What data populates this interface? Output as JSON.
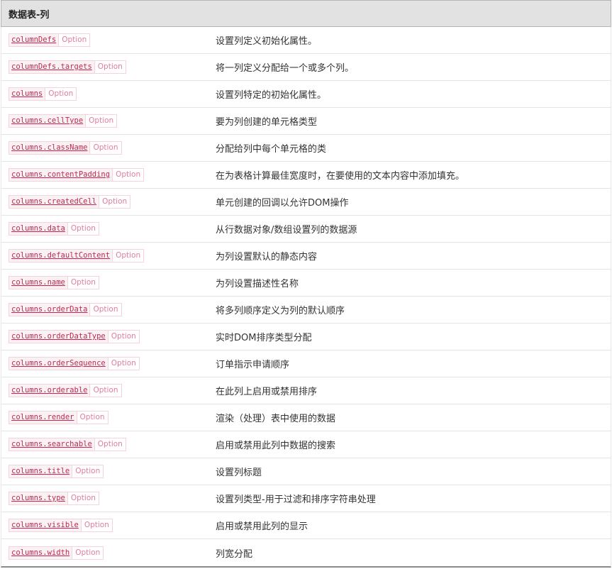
{
  "header": {
    "title": "数据表-列"
  },
  "rows": [
    {
      "name": "columnDefs",
      "type": "Option",
      "description": "设置列定义初始化属性。"
    },
    {
      "name": "columnDefs.targets",
      "type": "Option",
      "description": "将一列定义分配给一个或多个列。"
    },
    {
      "name": "columns",
      "type": "Option",
      "description": "设置列特定的初始化属性。"
    },
    {
      "name": "columns.cellType",
      "type": "Option",
      "description": "要为列创建的单元格类型"
    },
    {
      "name": "columns.className",
      "type": "Option",
      "description": "分配给列中每个单元格的类"
    },
    {
      "name": "columns.contentPadding",
      "type": "Option",
      "description": "在为表格计算最佳宽度时，在要使用的文本内容中添加填充。"
    },
    {
      "name": "columns.createdCell",
      "type": "Option",
      "description": "单元创建的回调以允许DOM操作"
    },
    {
      "name": "columns.data",
      "type": "Option",
      "description": "从行数据对象/数组设置列的数据源"
    },
    {
      "name": "columns.defaultContent",
      "type": "Option",
      "description": "为列设置默认的静态内容"
    },
    {
      "name": "columns.name",
      "type": "Option",
      "description": "为列设置描述性名称"
    },
    {
      "name": "columns.orderData",
      "type": "Option",
      "description": "将多列顺序定义为列的默认顺序"
    },
    {
      "name": "columns.orderDataType",
      "type": "Option",
      "description": "实时DOM排序类型分配"
    },
    {
      "name": "columns.orderSequence",
      "type": "Option",
      "description": "订单指示申请顺序"
    },
    {
      "name": "columns.orderable",
      "type": "Option",
      "description": "在此列上启用或禁用排序"
    },
    {
      "name": "columns.render",
      "type": "Option",
      "description": "渲染（处理）表中使用的数据"
    },
    {
      "name": "columns.searchable",
      "type": "Option",
      "description": "启用或禁用此列中数据的搜索"
    },
    {
      "name": "columns.title",
      "type": "Option",
      "description": "设置列标题"
    },
    {
      "name": "columns.type",
      "type": "Option",
      "description": "设置列类型-用于过滤和排序字符串处理"
    },
    {
      "name": "columns.visible",
      "type": "Option",
      "description": "启用或禁用此列的显示"
    },
    {
      "name": "columns.width",
      "type": "Option",
      "description": "列宽分配"
    }
  ]
}
